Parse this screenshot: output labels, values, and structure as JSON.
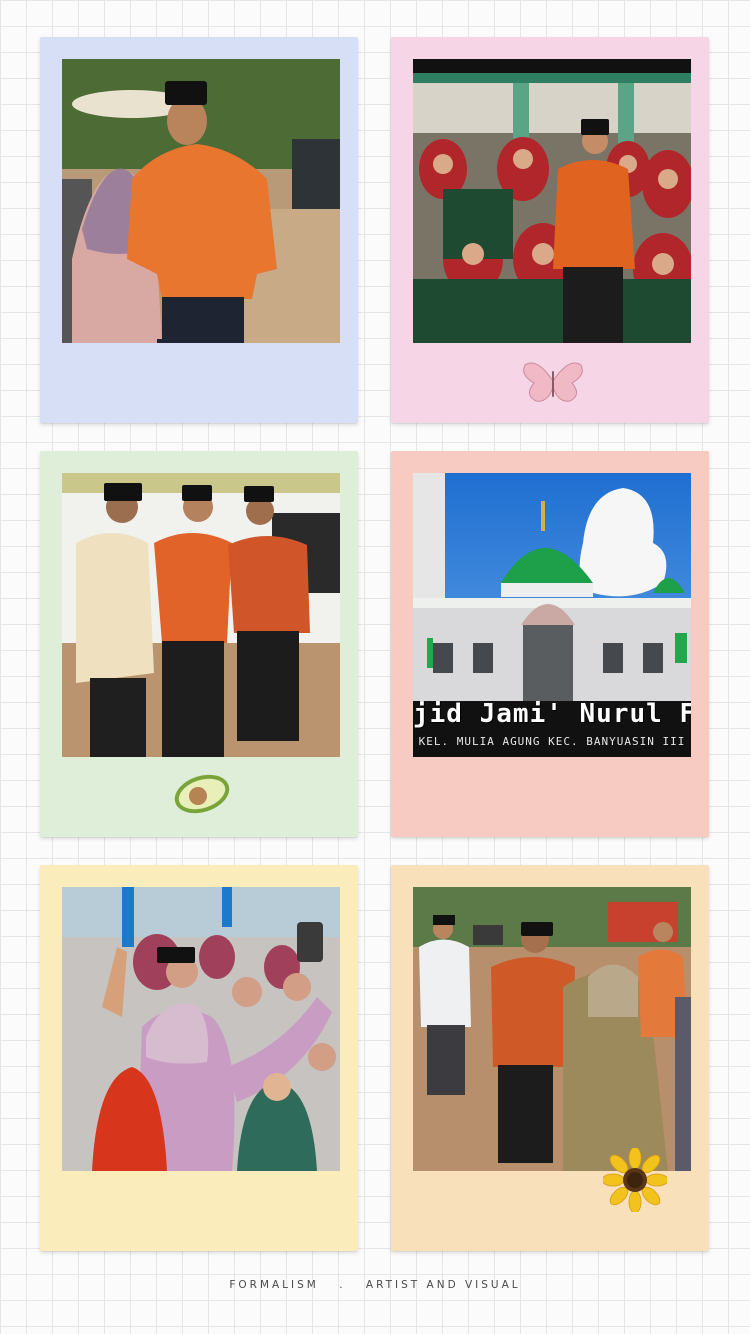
{
  "colors": {
    "card_blue": "#d6dff6",
    "card_pink": "#f6d6e6",
    "card_green": "#dfeed8",
    "card_peach": "#f7cac2",
    "card_yellow": "#fbedbb",
    "card_orange": "#f8e0bb"
  },
  "cards": [
    {
      "sticker": "none"
    },
    {
      "sticker": "butterfly-icon"
    },
    {
      "sticker": "avocado-icon"
    },
    {
      "sticker": "none"
    },
    {
      "sticker": "none"
    },
    {
      "sticker": "sunflower-icon"
    }
  ],
  "banner": {
    "title": "jid Jami' Nurul Fa",
    "subtitle": "KEL. MULIA AGUNG KEC. BANYUASIN III"
  },
  "footer": {
    "left": "FORMALISM",
    "separator": ".",
    "right": "ARTIST AND VISUAL"
  }
}
